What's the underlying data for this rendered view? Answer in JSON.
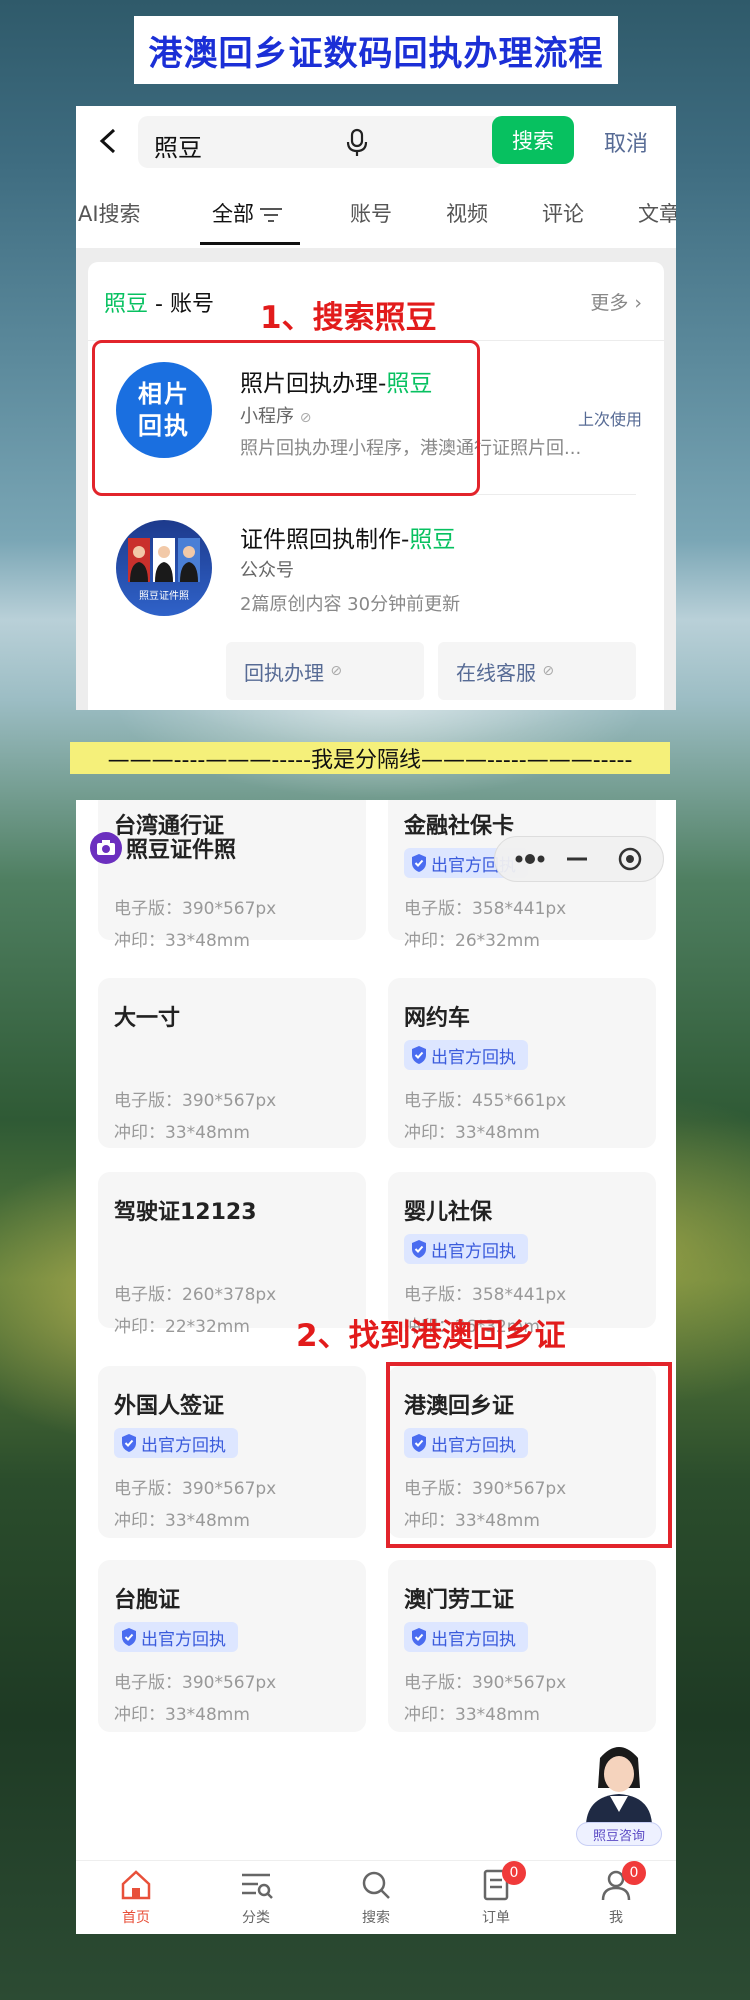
{
  "banner": {
    "title": "港澳回乡证数码回执办理流程"
  },
  "search": {
    "query": "照豆",
    "search_button": "搜索",
    "cancel": "取消",
    "tabs": [
      "AI搜索",
      "全部",
      "账号",
      "视频",
      "评论",
      "文章"
    ],
    "active_tab": "全部"
  },
  "results": {
    "section_green": "照豆",
    "section_rest": " - 账号",
    "more": "更多",
    "step1_label": "1、搜索照豆",
    "item1": {
      "logo_line1": "相片",
      "logo_line2": "回执",
      "title_main": "照片回执办理-",
      "title_green": "照豆",
      "type": "小程序",
      "badge": "上次使用",
      "desc": "照片回执办理小程序，港澳通行证照片回..."
    },
    "item2": {
      "logo_label": "照豆证件照",
      "title_main": "证件照回执制作-",
      "title_green": "照豆",
      "type": "公众号",
      "meta": "2篇原创内容  30分钟前更新",
      "btn1": "回执办理",
      "btn2": "在线客服"
    }
  },
  "separator": {
    "text": "———----———-----我是分隔线———-----———-----"
  },
  "mini_program": {
    "brand": "照豆证件照",
    "step2_label": "2、找到港澳回乡证",
    "assistant_label": "照豆咨询",
    "cells": [
      {
        "name": "台湾通行证",
        "badge": "",
        "digital": "电子版：390*567px",
        "print": "冲印：33*48mm"
      },
      {
        "name": "金融社保卡",
        "badge": "出官方回执",
        "digital": "电子版：358*441px",
        "print": "冲印：26*32mm"
      },
      {
        "name": "大一寸",
        "badge": "",
        "digital": "电子版：390*567px",
        "print": "冲印：33*48mm"
      },
      {
        "name": "网约车",
        "badge": "出官方回执",
        "digital": "电子版：455*661px",
        "print": "冲印：33*48mm"
      },
      {
        "name": "驾驶证12123",
        "badge": "",
        "digital": "电子版：260*378px",
        "print": "冲印：22*32mm"
      },
      {
        "name": "婴儿社保",
        "badge": "出官方回执",
        "digital": "电子版：358*441px",
        "print": "冲印：26*32mm"
      },
      {
        "name": "外国人签证",
        "badge": "出官方回执",
        "digital": "电子版：390*567px",
        "print": "冲印：33*48mm"
      },
      {
        "name": "港澳回乡证",
        "badge": "出官方回执",
        "digital": "电子版：390*567px",
        "print": "冲印：33*48mm"
      },
      {
        "name": "台胞证",
        "badge": "出官方回执",
        "digital": "电子版：390*567px",
        "print": "冲印：33*48mm"
      },
      {
        "name": "澳门劳工证",
        "badge": "出官方回执",
        "digital": "电子版：390*567px",
        "print": "冲印：33*48mm"
      }
    ],
    "tabbar": [
      {
        "label": "首页",
        "icon": "home-icon",
        "count": ""
      },
      {
        "label": "分类",
        "icon": "category-icon",
        "count": ""
      },
      {
        "label": "搜索",
        "icon": "search-icon",
        "count": ""
      },
      {
        "label": "订单",
        "icon": "order-icon",
        "count": "0"
      },
      {
        "label": "我",
        "icon": "user-icon",
        "count": "0"
      }
    ]
  },
  "colors": {
    "wechat_green": "#07c160",
    "annotation_red": "#e2242b",
    "banner_blue": "#1b2fd6"
  }
}
